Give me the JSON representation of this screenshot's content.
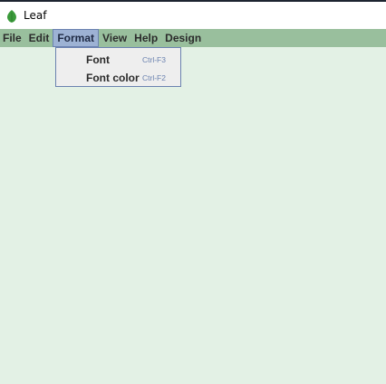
{
  "window": {
    "title": "Leaf",
    "icon": "leaf-icon"
  },
  "menubar": {
    "items": [
      {
        "label": "File"
      },
      {
        "label": "Edit"
      },
      {
        "label": "Format"
      },
      {
        "label": "View"
      },
      {
        "label": "Help"
      },
      {
        "label": "Design"
      }
    ],
    "active": "Format"
  },
  "format_menu": {
    "items": [
      {
        "label": "Font",
        "shortcut": "Ctrl-F3"
      },
      {
        "label": "Font color",
        "shortcut": "Ctrl-F2"
      }
    ]
  },
  "colors": {
    "menubar_bg": "#99bf9d",
    "content_bg": "#e3f1e5",
    "active_menu_bg": "#9db2d4",
    "accent_border": "#6b82b0"
  }
}
